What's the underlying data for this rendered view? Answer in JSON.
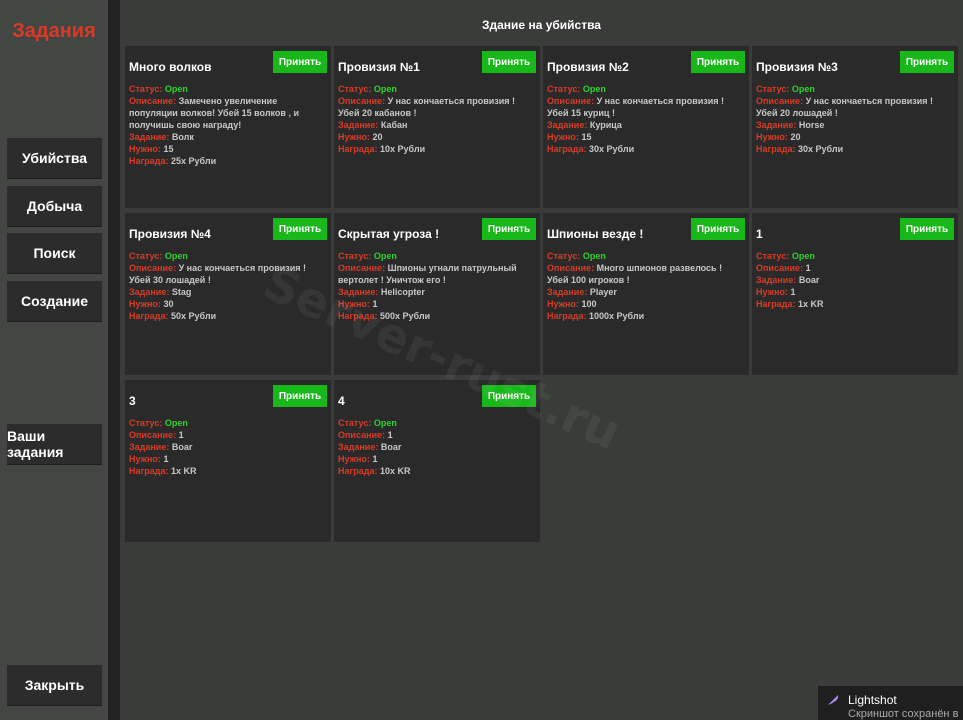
{
  "sidebar": {
    "title": "Задания",
    "buttons": [
      {
        "label": "Убийства"
      },
      {
        "label": "Добыча"
      },
      {
        "label": "Поиск"
      },
      {
        "label": "Создание"
      },
      {
        "label": "Ваши задания"
      },
      {
        "label": "Закрыть"
      }
    ]
  },
  "main": {
    "title": "Здание на убийства",
    "labels": {
      "status": "Статус:",
      "description": "Описание:",
      "task": "Задание:",
      "need": "Нужно:",
      "reward": "Награда:"
    },
    "accept_label": "Принять",
    "cards": [
      {
        "title": "Много волков",
        "status": "Open",
        "description": "Замечено увеличение популяции волков! Убей 15 волков , и получишь свою награду!",
        "task": "Волк",
        "need": "15",
        "reward": "25x Рубли"
      },
      {
        "title": "Провизия №1",
        "status": "Open",
        "description": " У нас кончаеться провизия ! Убей 20 кабанов !",
        "task": "Кабан",
        "need": "20",
        "reward": "10x Рубли"
      },
      {
        "title": "Провизия №2",
        "status": "Open",
        "description": "У нас кончаеться провизия ! Убей 15 куриц !",
        "task": "Курица",
        "need": "15",
        "reward": "30x Рубли"
      },
      {
        "title": "Провизия №3",
        "status": "Open",
        "description": "У нас кончаеться провизия ! Убей 20 лошадей !",
        "task": "Horse",
        "need": "20",
        "reward": "30x Рубли"
      },
      {
        "title": "Провизия №4",
        "status": "Open",
        "description": "У нас кончаеться провизия ! Убей 30 лошадей !",
        "task": "Stag",
        "need": "30",
        "reward": "50x Рубли"
      },
      {
        "title": "Скрытая угроза !",
        "status": "Open",
        "description": "Шпионы угнали патрульный вертолет ! Уничтож его !",
        "task": "Helicopter",
        "need": "1",
        "reward": "500x Рубли"
      },
      {
        "title": "Шпионы везде !",
        "status": "Open",
        "description": "Много шпионов развелось ! Убей 100 игроков !",
        "task": "Player",
        "need": "100",
        "reward": "1000x Рубли"
      },
      {
        "title": "1",
        "status": "Open",
        "description": "1",
        "task": "Boar",
        "need": "1",
        "reward": "1x KR"
      },
      {
        "title": "3",
        "status": "Open",
        "description": "1",
        "task": "Boar",
        "need": "1",
        "reward": "1x KR"
      },
      {
        "title": "4",
        "status": "Open",
        "description": "1",
        "task": "Boar",
        "need": "1",
        "reward": "10x KR"
      }
    ]
  },
  "watermark": "Server-rust.ru",
  "toast": {
    "title": "Lightshot",
    "subtitle": "Скриншот сохранён в"
  },
  "colors": {
    "accent_red": "#d83a26",
    "accept_green": "#19b81a",
    "open_green": "#2fd32f"
  }
}
